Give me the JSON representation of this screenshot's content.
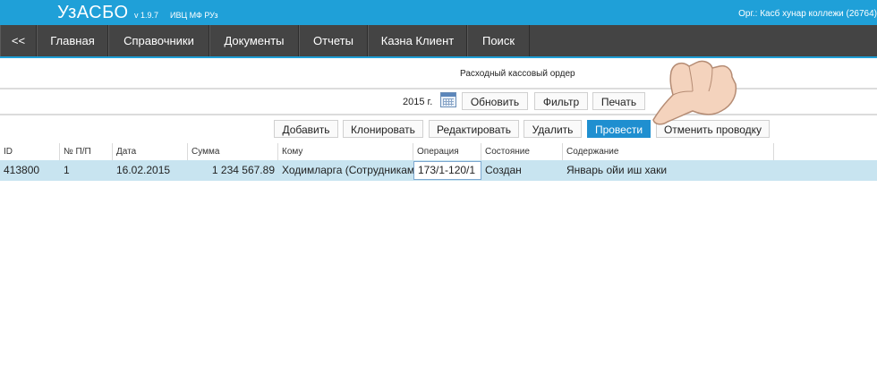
{
  "app": {
    "title": "УзАСБО",
    "version": "v 1.9.7",
    "vendor": "ИВЦ МФ РУз",
    "organization": "Орг.: Касб хунар коллежи  (26764)"
  },
  "nav": {
    "back": "<<",
    "items": [
      "Главная",
      "Справочники",
      "Документы",
      "Отчеты",
      "Казна Клиент",
      "Поиск"
    ]
  },
  "document": {
    "caption": "Расходный кассовый ордер"
  },
  "filter_bar": {
    "year": "2015 г.",
    "refresh": "Обновить",
    "filter": "Фильтр",
    "print": "Печать"
  },
  "actions": {
    "add": "Добавить",
    "clone": "Клонировать",
    "edit": "Редактировать",
    "delete": "Удалить",
    "post": "Провести",
    "unpost": "Отменить проводку"
  },
  "table": {
    "columns": [
      "ID",
      "№ П/П",
      "Дата",
      "Сумма",
      "Кому",
      "Операция",
      "Состояние",
      "Содержание"
    ],
    "rows": [
      [
        "413800",
        "1",
        "16.02.2015",
        "1 234 567.89",
        "Ходимларга (Сотрудникам",
        "173/1-120/1",
        "Создан",
        "Январь ойи иш хаки"
      ]
    ]
  },
  "colors": {
    "topbar": "#1fa0d8",
    "navbar": "#444444",
    "primary_button": "#1f8fd0",
    "selected_row": "#c8e4f0"
  }
}
